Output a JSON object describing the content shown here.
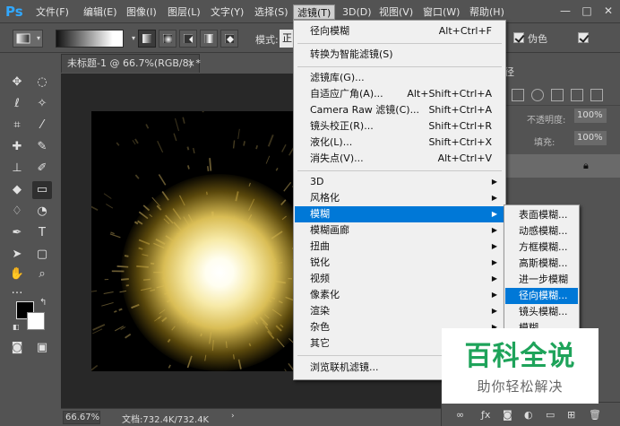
{
  "app": {
    "logo": "Ps"
  },
  "menubar": {
    "items": [
      {
        "label": "文件(F)"
      },
      {
        "label": "编辑(E)"
      },
      {
        "label": "图像(I)"
      },
      {
        "label": "图层(L)"
      },
      {
        "label": "文字(Y)"
      },
      {
        "label": "选择(S)"
      },
      {
        "label": "滤镜(T)",
        "active": true
      },
      {
        "label": "3D(D)"
      },
      {
        "label": "视图(V)"
      },
      {
        "label": "窗口(W)"
      },
      {
        "label": "帮助(H)"
      }
    ],
    "window_controls": [
      "—",
      "□",
      "✕"
    ]
  },
  "options": {
    "mode_label": "模式:",
    "mode_value": "正",
    "transparency_label": "伪色",
    "checked_transparency": true
  },
  "document": {
    "tab_title": "未标题-1 @ 66.7%(RGB/8) *",
    "close_glyph": "×"
  },
  "status": {
    "zoom": "66.67%",
    "doc_info": "文档:732.4K/732.4K",
    "arrow": "›"
  },
  "panels": {
    "paths_tab": "径",
    "opacity_label": "不透明度:",
    "opacity_value": "100%",
    "fill_label": "填充:",
    "fill_value": "100%"
  },
  "filter_menu": {
    "items": [
      {
        "label": "径向模糊",
        "shortcut": "Alt+Ctrl+F"
      },
      {
        "label": "转换为智能滤镜(S)"
      },
      {
        "label": "滤镜库(G)..."
      },
      {
        "label": "自适应广角(A)...",
        "shortcut": "Alt+Shift+Ctrl+A"
      },
      {
        "label": "Camera Raw 滤镜(C)...",
        "shortcut": "Shift+Ctrl+A"
      },
      {
        "label": "镜头校正(R)...",
        "shortcut": "Shift+Ctrl+R"
      },
      {
        "label": "液化(L)...",
        "shortcut": "Shift+Ctrl+X"
      },
      {
        "label": "消失点(V)...",
        "shortcut": "Alt+Ctrl+V"
      },
      {
        "label": "3D",
        "submenu": true
      },
      {
        "label": "风格化",
        "submenu": true
      },
      {
        "label": "模糊",
        "submenu": true,
        "highlighted": true
      },
      {
        "label": "模糊画廊",
        "submenu": true
      },
      {
        "label": "扭曲",
        "submenu": true
      },
      {
        "label": "锐化",
        "submenu": true
      },
      {
        "label": "视频",
        "submenu": true
      },
      {
        "label": "像素化",
        "submenu": true
      },
      {
        "label": "渲染",
        "submenu": true
      },
      {
        "label": "杂色",
        "submenu": true
      },
      {
        "label": "其它",
        "submenu": true
      },
      {
        "label": "浏览联机滤镜..."
      }
    ]
  },
  "blur_submenu": {
    "items": [
      {
        "label": "表面模糊..."
      },
      {
        "label": "动感模糊..."
      },
      {
        "label": "方框模糊..."
      },
      {
        "label": "高斯模糊..."
      },
      {
        "label": "进一步模糊"
      },
      {
        "label": "径向模糊...",
        "highlighted": true
      },
      {
        "label": "镜头模糊..."
      },
      {
        "label": "模糊"
      }
    ]
  },
  "watermark": {
    "title": "百科全说",
    "subtitle": "助你轻松解决"
  },
  "colors": {
    "menu_highlight": "#0078d7",
    "ps_blue": "#31a8ff",
    "watermark_green": "#1ea35a",
    "ui_bg": "#535353"
  }
}
